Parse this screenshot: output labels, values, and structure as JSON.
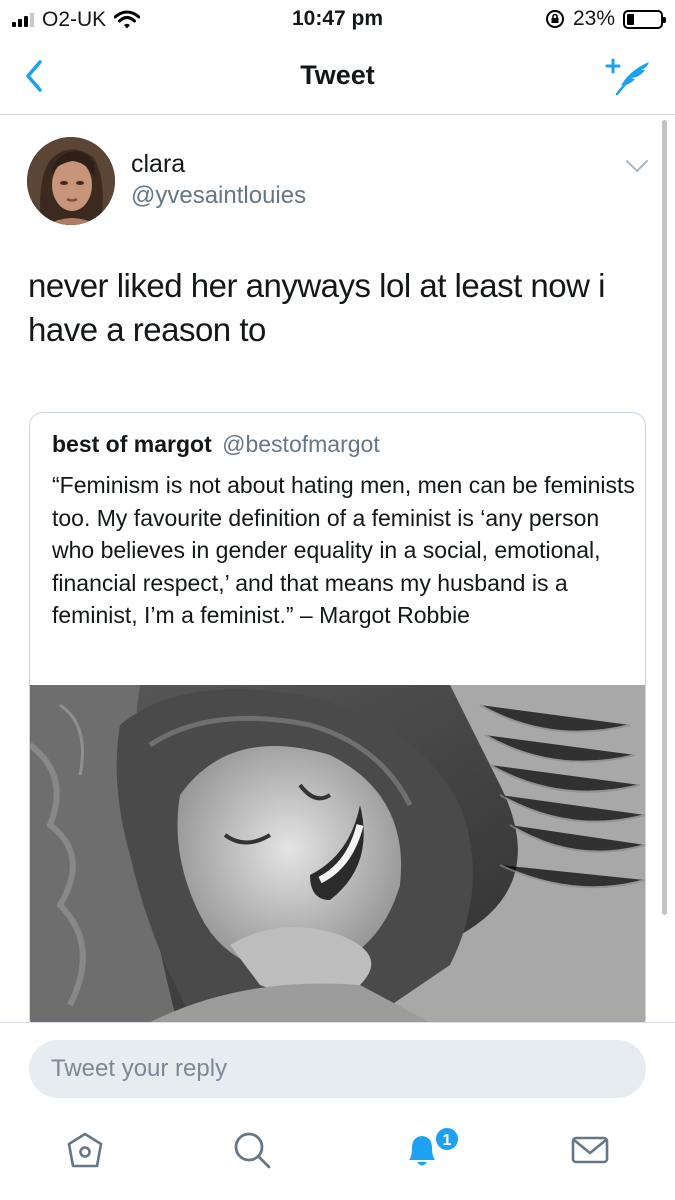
{
  "status_bar": {
    "carrier": "O2-UK",
    "time": "10:47 pm",
    "battery_percent": "23%",
    "battery_level": 0.23,
    "icons": [
      "signal-icon",
      "wifi-icon",
      "rotation-lock-icon",
      "battery-icon"
    ]
  },
  "nav": {
    "title": "Tweet",
    "back_icon": "chevron-left-icon",
    "compose_icon": "compose-tweet-icon"
  },
  "tweet": {
    "author_name": "clara",
    "author_handle": "@yvesaintlouies",
    "text": "never liked her anyways lol at least now i have a reason to",
    "menu_icon": "chevron-down-icon"
  },
  "quoted_tweet": {
    "author_name": "best of margot",
    "author_handle": "@bestofmargot",
    "text": "“Feminism is not about hating men, men can be feminists too. My favourite definition of a feminist is ‘any person who believes in gender equality in a social, emotional, financial respect,’ and that means my husband is a feminist, I’m a feminist.” – Margot Robbie"
  },
  "reply": {
    "placeholder": "Tweet your reply"
  },
  "tab_bar": {
    "items": [
      "home-icon",
      "search-icon",
      "notifications-icon",
      "messages-icon"
    ],
    "notification_count": "1"
  },
  "colors": {
    "accent": "#1da1f2",
    "text": "#14171a",
    "secondary": "#657786",
    "reply_field": "#e6ecf0"
  }
}
